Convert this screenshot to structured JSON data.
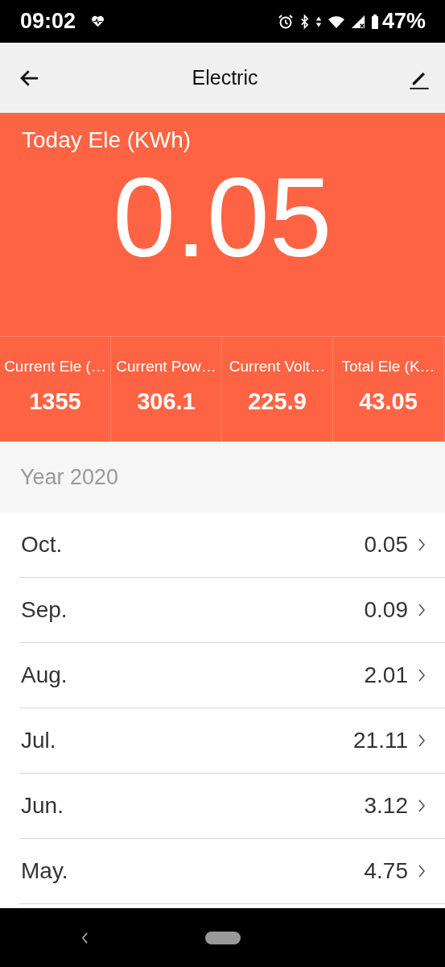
{
  "status_bar": {
    "time": "09:02",
    "battery": "47%"
  },
  "header": {
    "title": "Electric"
  },
  "today": {
    "label": "Today Ele (KWh)",
    "value": "0.05"
  },
  "stats": [
    {
      "label": "Current Ele (…",
      "value": "1355"
    },
    {
      "label": "Current Pow…",
      "value": "306.1"
    },
    {
      "label": "Current Volt…",
      "value": "225.9"
    },
    {
      "label": "Total Ele (K…",
      "value": "43.05"
    }
  ],
  "year": "Year 2020",
  "months": [
    {
      "name": "Oct.",
      "value": "0.05"
    },
    {
      "name": "Sep.",
      "value": "0.09"
    },
    {
      "name": "Aug.",
      "value": "2.01"
    },
    {
      "name": "Jul.",
      "value": "21.11"
    },
    {
      "name": "Jun.",
      "value": "3.12"
    },
    {
      "name": "May.",
      "value": "4.75"
    }
  ]
}
